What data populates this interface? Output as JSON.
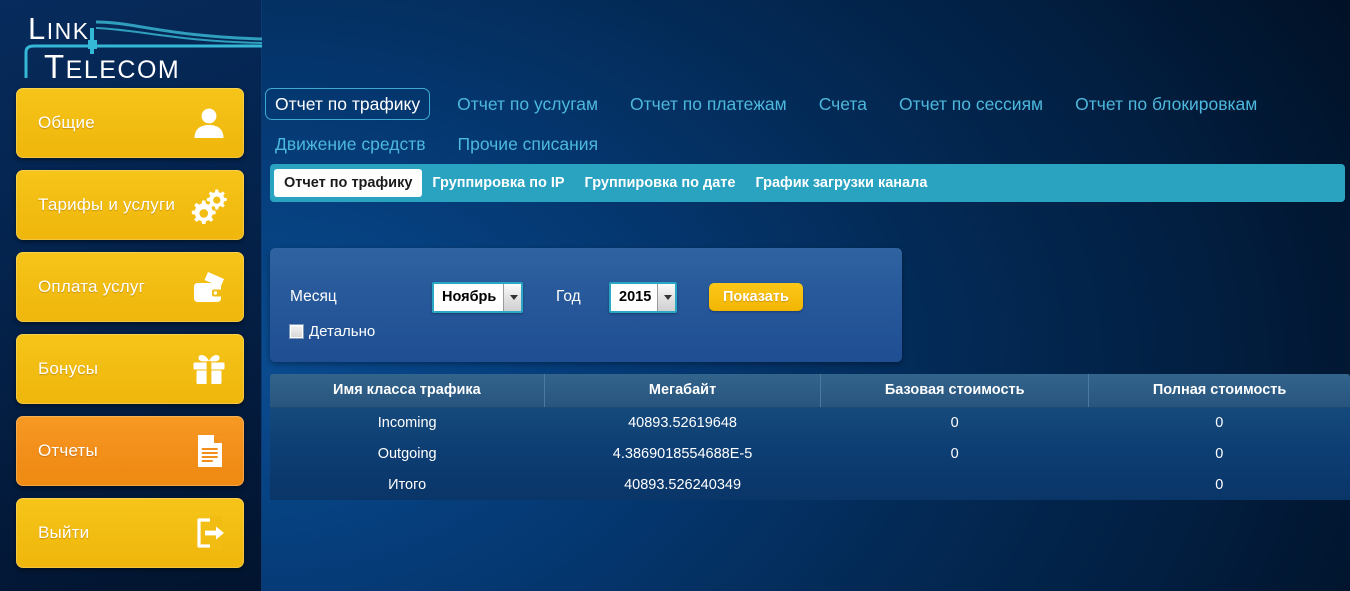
{
  "brand": {
    "line1": "LINK",
    "line2": "TELECOM"
  },
  "sidebar": {
    "items": [
      {
        "label": "Общие",
        "icon": "user-icon",
        "active": false
      },
      {
        "label": "Тарифы и услуги",
        "icon": "gears-icon",
        "active": false
      },
      {
        "label": "Оплата услуг",
        "icon": "wallet-icon",
        "active": false
      },
      {
        "label": "Бонусы",
        "icon": "gift-icon",
        "active": false
      },
      {
        "label": "Отчеты",
        "icon": "document-icon",
        "active": true
      },
      {
        "label": "Выйти",
        "icon": "logout-icon",
        "active": false
      }
    ]
  },
  "topnav": {
    "items": [
      {
        "label": "Отчет по трафику",
        "active": true
      },
      {
        "label": "Отчет по услугам",
        "active": false
      },
      {
        "label": "Отчет по платежам",
        "active": false
      },
      {
        "label": "Счета",
        "active": false
      },
      {
        "label": "Отчет по сессиям",
        "active": false
      },
      {
        "label": "Отчет по блокировкам",
        "active": false
      },
      {
        "label": "Движение средств",
        "active": false
      },
      {
        "label": "Прочие списания",
        "active": false
      }
    ]
  },
  "subtabs": {
    "items": [
      {
        "label": "Отчет по трафику",
        "active": true
      },
      {
        "label": "Группировка по IP",
        "active": false
      },
      {
        "label": "Группировка по дате",
        "active": false
      },
      {
        "label": "График загрузки канала",
        "active": false
      }
    ]
  },
  "filter": {
    "month_label": "Месяц",
    "month_value": "Ноябрь",
    "year_label": "Год",
    "year_value": "2015",
    "submit_label": "Показать",
    "detail_label": "Детально",
    "detail_checked": false
  },
  "table": {
    "headers": [
      "Имя класса трафика",
      "Мегабайт",
      "Базовая стоимость",
      "Полная стоимость"
    ],
    "rows": [
      {
        "name": "Incoming",
        "megabytes": "40893.52619648",
        "base_cost": "0",
        "full_cost": "0"
      },
      {
        "name": "Outgoing",
        "megabytes": "4.3869018554688E-5",
        "base_cost": "0",
        "full_cost": "0"
      },
      {
        "name": "Итого",
        "megabytes": "40893.526240349",
        "base_cost": "",
        "full_cost": "0"
      }
    ]
  },
  "colors": {
    "accent_yellow": "#f2bd12",
    "accent_orange": "#f28f1a",
    "teal": "#2aa3c1",
    "nav_link": "#4db8dd",
    "panel_blue": "#27589a",
    "bg_dark": "#021533"
  }
}
